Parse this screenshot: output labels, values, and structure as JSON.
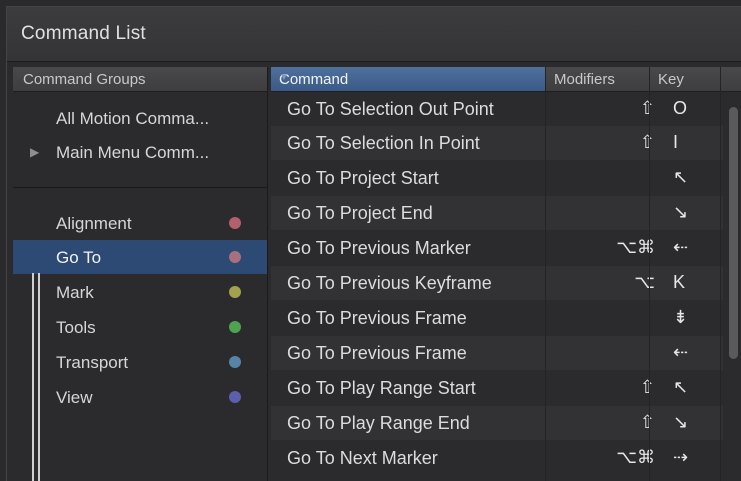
{
  "window": {
    "title": "Command List"
  },
  "groups": {
    "header": "Command Groups",
    "top_items": [
      {
        "label": "All Motion Comma..."
      },
      {
        "label": "Main Menu Comm...",
        "disclosure": "▶"
      }
    ],
    "items": [
      {
        "label": "Alignment",
        "color": "#b3606c"
      },
      {
        "label": "Go To",
        "color": "#a8707e",
        "selected": true
      },
      {
        "label": "Mark",
        "color": "#a5a04e"
      },
      {
        "label": "Tools",
        "color": "#4fa24f"
      },
      {
        "label": "Transport",
        "color": "#5684a6"
      },
      {
        "label": "View",
        "color": "#5b5fac"
      }
    ]
  },
  "table": {
    "columns": {
      "command": "Command",
      "modifiers": "Modifiers",
      "key": "Key"
    },
    "sorted_column": "command",
    "rows": [
      {
        "command": "Go To Selection Out Point",
        "modifiers": "⇧",
        "key": "O"
      },
      {
        "command": "Go To Selection In Point",
        "modifiers": "⇧",
        "key": "I"
      },
      {
        "command": "Go To Project Start",
        "modifiers": "",
        "key": "↖"
      },
      {
        "command": "Go To Project End",
        "modifiers": "",
        "key": "↘"
      },
      {
        "command": "Go To Previous Marker",
        "modifiers": "⌥⌘",
        "key": "⇠"
      },
      {
        "command": "Go To Previous Keyframe",
        "modifiers": "⌥",
        "key": "K"
      },
      {
        "command": "Go To Previous Frame",
        "modifiers": "",
        "key": "⇟"
      },
      {
        "command": "Go To Previous Frame",
        "modifiers": "",
        "key": "⇠"
      },
      {
        "command": "Go To Play Range Start",
        "modifiers": "⇧",
        "key": "↖"
      },
      {
        "command": "Go To Play Range End",
        "modifiers": "⇧",
        "key": "↘"
      },
      {
        "command": "Go To Next Marker",
        "modifiers": "⌥⌘",
        "key": "⇢"
      }
    ]
  },
  "colors": {
    "selection": "#2d4a74",
    "sorted_header": "#4a6a98"
  }
}
